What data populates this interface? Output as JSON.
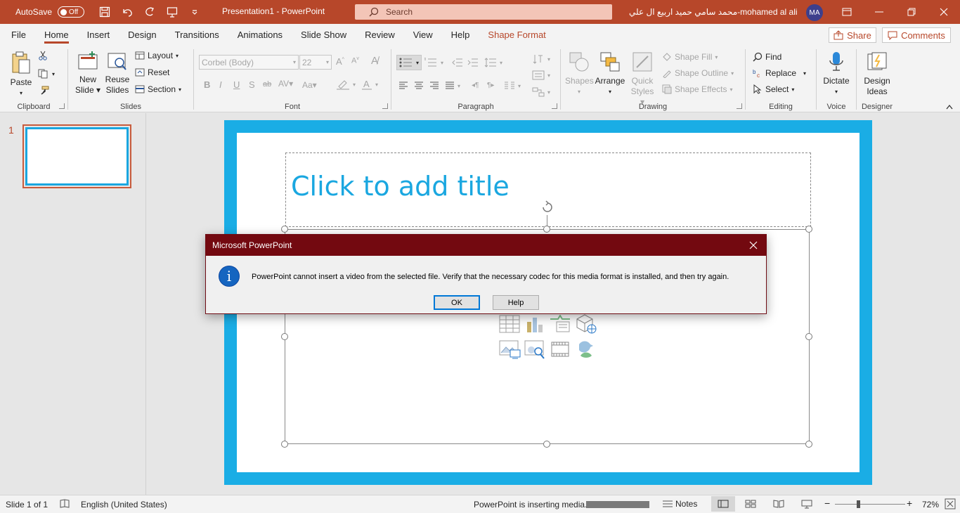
{
  "titlebar": {
    "autosave_label": "AutoSave",
    "autosave_state": "Off",
    "doc_title": "Presentation1  -  PowerPoint",
    "search_placeholder": "Search",
    "user_name": "محمد سامي حميد اربيع ال علي-mohamed  al ali",
    "user_initials": "MA"
  },
  "tabs": [
    "File",
    "Home",
    "Insert",
    "Design",
    "Transitions",
    "Animations",
    "Slide Show",
    "Review",
    "View",
    "Help",
    "Shape Format"
  ],
  "active_tab": "Home",
  "share_label": "Share",
  "comments_label": "Comments",
  "ribbon": {
    "clipboard": {
      "label": "Clipboard",
      "paste": "Paste"
    },
    "slides": {
      "label": "Slides",
      "new_slide_1": "New",
      "new_slide_2": "Slide",
      "reuse_1": "Reuse",
      "reuse_2": "Slides",
      "layout": "Layout",
      "reset": "Reset",
      "section": "Section"
    },
    "font": {
      "label": "Font",
      "font_name": "Corbel (Body)",
      "font_size": "22"
    },
    "paragraph": {
      "label": "Paragraph"
    },
    "drawing": {
      "label": "Drawing",
      "shapes": "Shapes",
      "arrange": "Arrange",
      "quick_1": "Quick",
      "quick_2": "Styles",
      "shape_fill": "Shape Fill",
      "shape_outline": "Shape Outline",
      "shape_effects": "Shape Effects"
    },
    "editing": {
      "label": "Editing",
      "find": "Find",
      "replace": "Replace",
      "select": "Select"
    },
    "voice": {
      "label": "Voice",
      "dictate": "Dictate"
    },
    "designer": {
      "label": "Designer",
      "design_1": "Design",
      "design_2": "Ideas"
    }
  },
  "slide_panel": {
    "slide_number": "1"
  },
  "slide": {
    "title_placeholder": "Click to add title"
  },
  "dialog": {
    "title": "Microsoft PowerPoint",
    "message": "PowerPoint cannot insert a video from the selected file. Verify that the necessary codec for this media format is installed, and then try again.",
    "ok": "OK",
    "help": "Help"
  },
  "statusbar": {
    "slide_info": "Slide 1 of 1",
    "language": "English (United States)",
    "status_message": "PowerPoint is inserting media.",
    "notes": "Notes",
    "zoom": "72%"
  },
  "colors": {
    "accent": "#b7472a",
    "slide_border": "#1aade5",
    "dialog_title": "#730910"
  }
}
